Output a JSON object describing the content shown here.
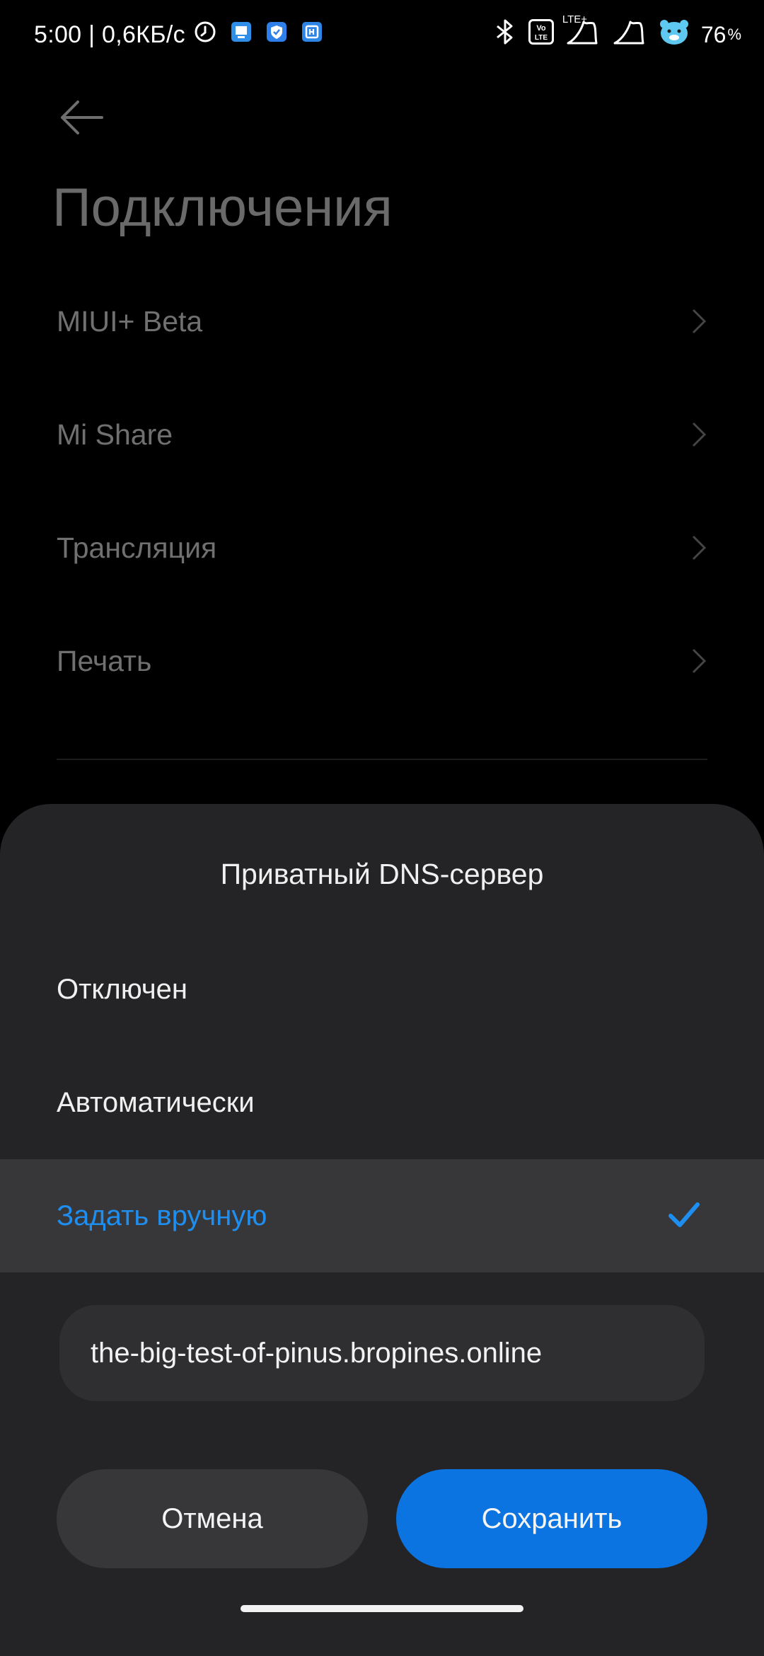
{
  "status_bar": {
    "time_speed": "5:00 | 0,6КБ/с",
    "lte_label": "LTE+",
    "volte_label": "Vo LTE",
    "battery": "76",
    "battery_unit": "%",
    "icons": [
      "alarm-icon",
      "app-notification-icon",
      "shield-icon",
      "app-icon",
      "bluetooth-icon",
      "volte-icon",
      "signal-icon",
      "signal-icon",
      "battery-mascot-icon"
    ]
  },
  "settings": {
    "title": "Подключения",
    "items": [
      {
        "label": "MIUI+ Beta"
      },
      {
        "label": "Mi Share"
      },
      {
        "label": "Трансляция"
      },
      {
        "label": "Печать"
      }
    ]
  },
  "dialog": {
    "title": "Приватный DNS-сервер",
    "options": [
      {
        "label": "Отключен",
        "selected": false
      },
      {
        "label": "Автоматически",
        "selected": false
      },
      {
        "label": "Задать вручную",
        "selected": true
      }
    ],
    "hostname_value": "the-big-test-of-pinus.bropines.online",
    "cancel_label": "Отмена",
    "save_label": "Сохранить"
  },
  "colors": {
    "accent": "#1e8ff0",
    "primary_button": "#0b74e0",
    "sheet_background": "#242426",
    "page_background": "#000000"
  }
}
